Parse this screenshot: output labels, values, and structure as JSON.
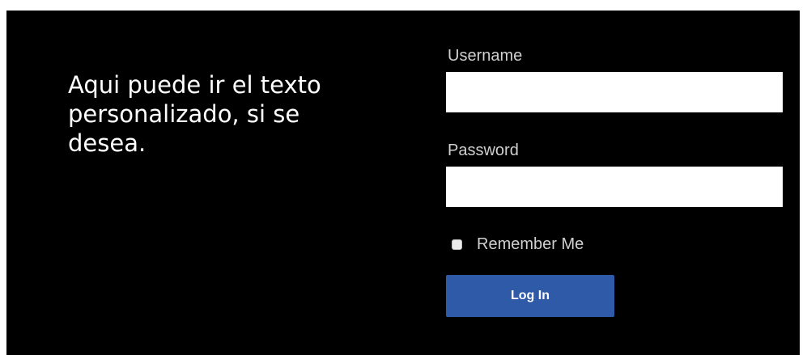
{
  "intro": {
    "text": "Aqui puede ir el texto personalizado, si se desea."
  },
  "login_form": {
    "username_label": "Username",
    "username_value": "",
    "password_label": "Password",
    "password_value": "",
    "remember_label": "Remember Me",
    "remember_checked": false,
    "submit_label": "Log In"
  },
  "colors": {
    "background": "#000000",
    "label_text": "#cfcfcf",
    "button": "#2e5aa8",
    "button_text": "#ffffff"
  },
  "icons": {
    "remember_checkbox": "checkbox-unchecked"
  }
}
